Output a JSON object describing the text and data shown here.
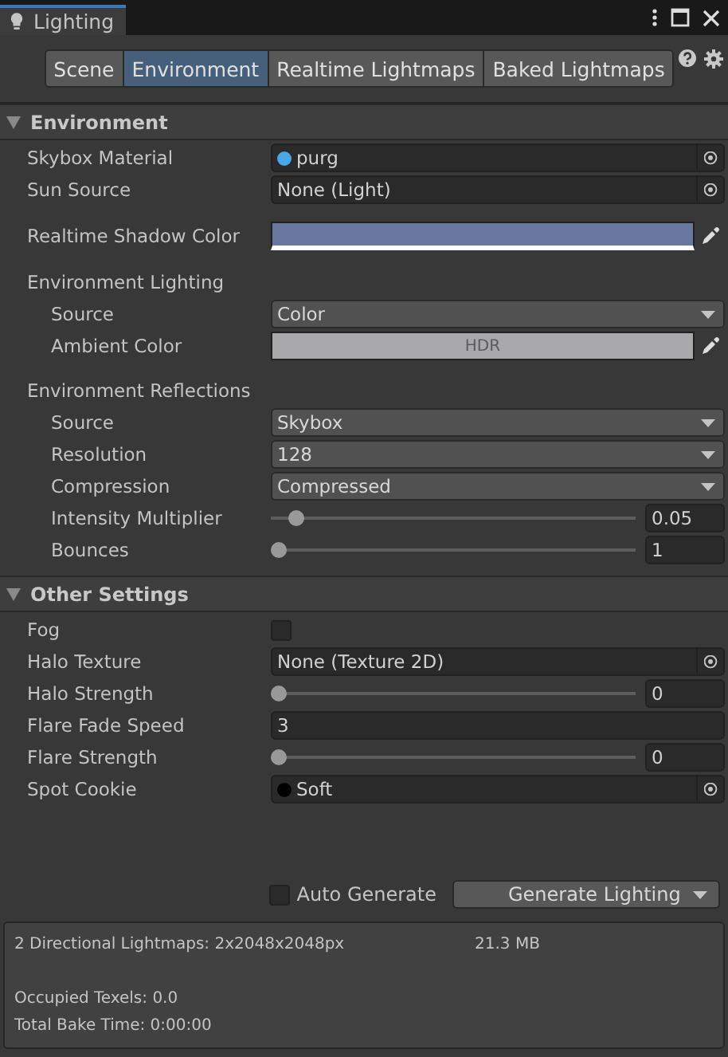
{
  "window": {
    "title": "Lighting"
  },
  "tabs": [
    {
      "label": "Scene",
      "selected": false
    },
    {
      "label": "Environment",
      "selected": true
    },
    {
      "label": "Realtime Lightmaps",
      "selected": false
    },
    {
      "label": "Baked Lightmaps",
      "selected": false
    }
  ],
  "sections": [
    {
      "title": "Environment",
      "expanded": true,
      "rows": [
        {
          "kind": "object",
          "label": "Skybox Material",
          "value": "purg",
          "color": "#4aa8e8"
        },
        {
          "kind": "object",
          "label": "Sun Source",
          "value": "None (Light)"
        },
        {
          "kind": "color",
          "label": "Realtime Shadow Color",
          "color": "#6a789f"
        },
        {
          "kind": "group",
          "label": "Environment Lighting",
          "children": [
            {
              "kind": "dropdown",
              "label": "Source",
              "value": "Color"
            },
            {
              "kind": "color",
              "label": "Ambient Color",
              "color": "#a9a9ab",
              "hdr": "HDR"
            }
          ]
        },
        {
          "kind": "group",
          "label": "Environment Reflections",
          "children": [
            {
              "kind": "dropdown",
              "label": "Source",
              "value": "Skybox"
            },
            {
              "kind": "dropdown",
              "label": "Resolution",
              "value": "128"
            },
            {
              "kind": "dropdown",
              "label": "Compression",
              "value": "Compressed"
            },
            {
              "kind": "slider",
              "label": "Intensity Multiplier",
              "level": 0.05,
              "value": "0.05"
            },
            {
              "kind": "slider",
              "label": "Bounces",
              "level": 0,
              "value": "1"
            }
          ]
        }
      ]
    },
    {
      "title": "Other Settings",
      "expanded": true,
      "rows": [
        {
          "kind": "checkbox",
          "label": "Fog",
          "checked": false
        },
        {
          "kind": "object",
          "label": "Halo Texture",
          "value": "None (Texture 2D)"
        },
        {
          "kind": "slider",
          "label": "Halo Strength",
          "level": 0,
          "value": "0"
        },
        {
          "kind": "text",
          "label": "Flare Fade Speed",
          "value": "3"
        },
        {
          "kind": "slider",
          "label": "Flare Strength",
          "level": 0,
          "value": "0"
        },
        {
          "kind": "object",
          "label": "Spot Cookie",
          "value": "Soft",
          "color": "#000000"
        }
      ]
    }
  ],
  "footer": {
    "auto_generate": {
      "label": "Auto Generate",
      "checked": false
    },
    "generate_button": "Generate Lighting"
  },
  "info": {
    "lightmaps": "2 Directional Lightmaps: 2x2048x2048px",
    "size": "21.3 MB",
    "occupied": "Occupied Texels: 0.0",
    "bake_time": "Total Bake Time: 0:00:00"
  }
}
